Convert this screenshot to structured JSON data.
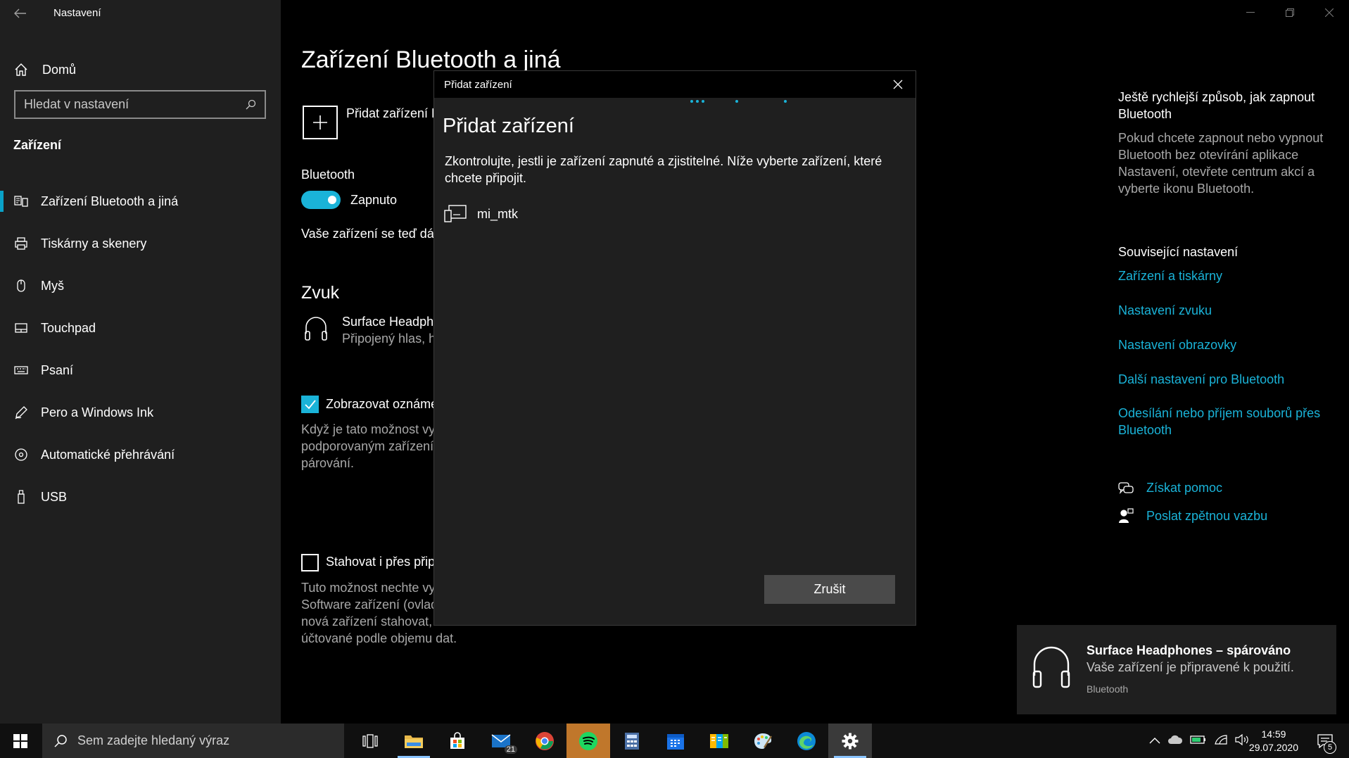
{
  "window": {
    "title": "Nastavení",
    "controls": [
      "minimize",
      "restore",
      "close"
    ]
  },
  "sidebar": {
    "home_label": "Domů",
    "search_placeholder": "Hledat v nastavení",
    "section": "Zařízení",
    "items": [
      {
        "label": "Zařízení Bluetooth a jiná",
        "icon": "bluetooth-devices-icon",
        "active": true
      },
      {
        "label": "Tiskárny a skenery",
        "icon": "printer-icon"
      },
      {
        "label": "Myš",
        "icon": "mouse-icon"
      },
      {
        "label": "Touchpad",
        "icon": "touchpad-icon"
      },
      {
        "label": "Psaní",
        "icon": "keyboard-icon"
      },
      {
        "label": "Pero a Windows Ink",
        "icon": "pen-icon"
      },
      {
        "label": "Automatické přehrávání",
        "icon": "autoplay-icon"
      },
      {
        "label": "USB",
        "icon": "usb-icon"
      }
    ]
  },
  "main": {
    "title": "Zařízení Bluetooth a jiná",
    "add_device_label": "Přidat zařízení B",
    "bluetooth_label": "Bluetooth",
    "bluetooth_state": "Zapnuto",
    "discoverable_text": "Vaše zařízení se teď dá z",
    "sound_heading": "Zvuk",
    "sound_device_name": "Surface Headpho",
    "sound_device_status": "Připojený hlas, hu",
    "show_notifications_label": "Zobrazovat oznáme",
    "show_notifications_desc": [
      "Když je tato možnost vyl",
      "podporovaným zařízením",
      "párování."
    ],
    "metered_label": "Stahovat i přes přip",
    "metered_desc": [
      "Tuto možnost nechte vy",
      "Software zařízení (ovlada",
      "nová zařízení stahovat, k",
      "účtované podle objemu dat."
    ]
  },
  "right": {
    "tip_title": "Ještě rychlejší způsob, jak zapnout Bluetooth",
    "tip_text": "Pokud chcete zapnout nebo vypnout Bluetooth bez otevírání aplikace Nastavení, otevřete centrum akcí a vyberte ikonu Bluetooth.",
    "related_title": "Související nastavení",
    "links": [
      "Zařízení a tiskárny",
      "Nastavení zvuku",
      "Nastavení obrazovky",
      "Další nastavení pro Bluetooth",
      "Odesílání nebo příjem souborů přes Bluetooth"
    ],
    "help": "Získat pomoc",
    "feedback": "Poslat zpětnou vazbu"
  },
  "dialog": {
    "window_title": "Přidat zařízení",
    "heading": "Přidat zařízení",
    "instruction": "Zkontrolujte, jestli je zařízení zapnuté a zjistitelné. Níže vyberte zařízení, které chcete připojit.",
    "devices": [
      {
        "name": "mi_mtk",
        "icon": "device-icon"
      }
    ],
    "cancel_label": "Zrušit"
  },
  "toast": {
    "title": "Surface Headphones – spárováno",
    "body": "Vaše zařízení je připravené k použití.",
    "source": "Bluetooth"
  },
  "taskbar": {
    "search_placeholder": "Sem zadejte hledaný výraz",
    "apps": [
      "task-view",
      "file-explorer",
      "store",
      "mail",
      "chrome",
      "spotify",
      "calculator",
      "calendar",
      "news",
      "paint",
      "edge",
      "settings"
    ],
    "mail_badge": "21",
    "time": "14:59",
    "date": "29.07.2020",
    "notification_count": "5"
  },
  "colors": {
    "accent": "#1ab3d8",
    "sidebar_bg": "#1f1f1f",
    "main_bg": "#000000"
  }
}
